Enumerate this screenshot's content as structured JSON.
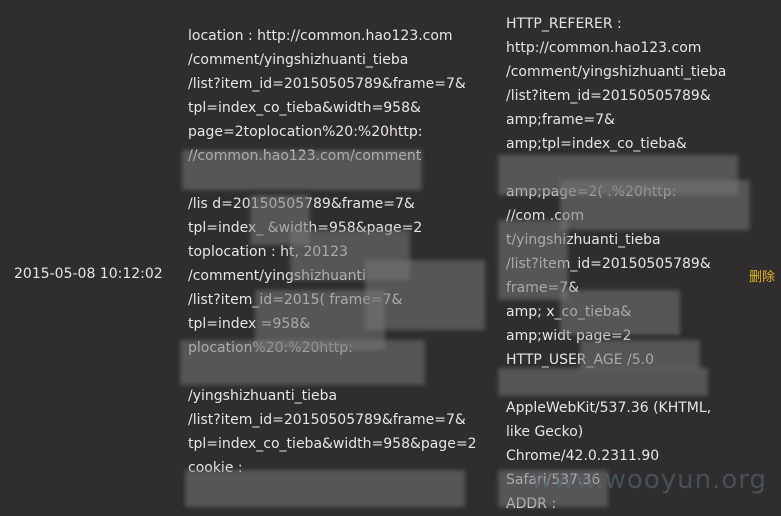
{
  "entry": {
    "datetime": "2015-05-08 10:12:02",
    "delete_label": "删除",
    "col1": [
      "location : http://common.hao123.com",
      "/comment/yingshizhuanti_tieba",
      "/list?item_id=20150505789&frame=7&",
      "tpl=index_co_tieba&width=958&",
      "page=2toplocation%20:%20http:",
      "//common.hao123.com/comment",
      "",
      "/lis      d=20150505789&frame=7&",
      "tpl=index_       &width=958&page=2",
      "toplocation : ht,             20123",
      "/comment/yingshizhuanti",
      "/list?item_id=2015(      frame=7&",
      "tpl=index         =958&",
      "             plocation%20:%20http:",
      "",
      "/yingshizhuanti_tieba",
      "/list?item_id=20150505789&frame=7&",
      "tpl=index_co_tieba&width=958&page=2",
      "cookie :"
    ],
    "col2": [
      "HTTP_REFERER :",
      "http://common.hao123.com",
      "/comment/yingshizhuanti_tieba",
      "/list?item_id=20150505789&",
      "amp;frame=7&",
      "amp;tpl=index_co_tieba&",
      "",
      "amp;page=2(               .%20http:",
      "//com           .com",
      "       t/yingshizhuanti_tieba",
      "/list?item_id=20150505789&",
      "      frame=7&",
      "amp;       x_co_tieba&",
      "amp;widt            page=2",
      "HTTP_USER_AGE          /5.0",
      "",
      "AppleWebKit/537.36 (KHTML,",
      "like Gecko)",
      "Chrome/42.0.2311.90",
      "Safari/537.36",
      "         ADDR :"
    ]
  },
  "watermark": "www.wooyun.org"
}
